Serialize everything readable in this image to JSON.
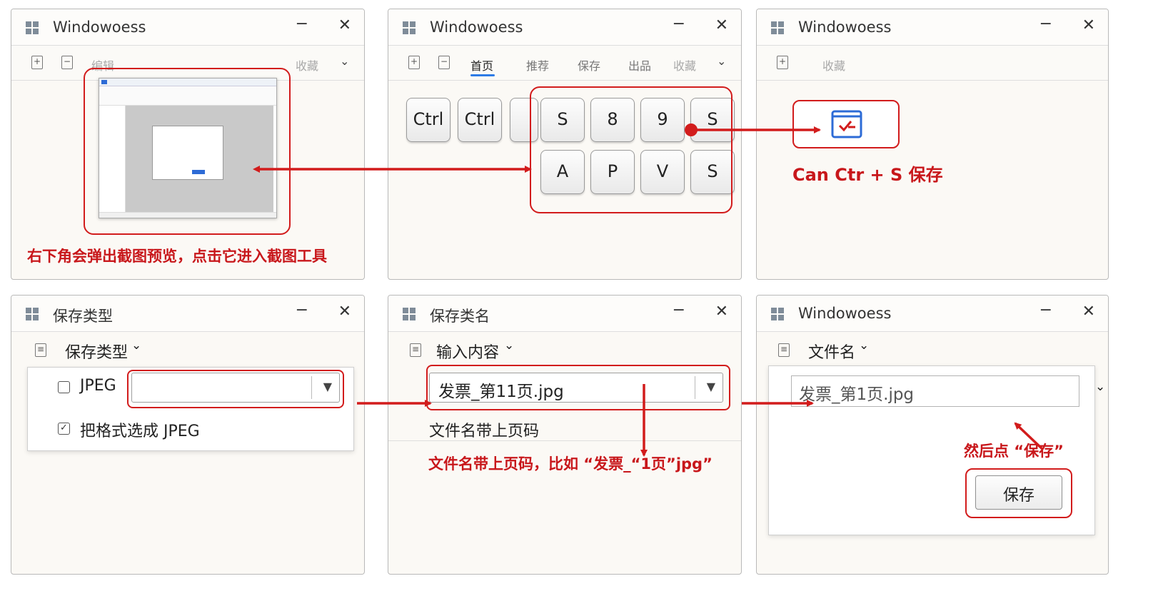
{
  "colors": {
    "accent_red": "#d21c1c",
    "tab_blue": "#2d7be6"
  },
  "icons": {
    "window": "windows-logo-icon",
    "add": "add-page-icon",
    "remove": "remove-page-icon",
    "doc": "document-icon",
    "save": "save-icon"
  },
  "p1": {
    "title": "Windowoess",
    "minimize": "−",
    "close": "✕",
    "toolbar_label": "编辑",
    "toolbar_right": "收藏",
    "chevron": "⌄",
    "caption": "右下角会弹出截图预览，点击它进入截图工具"
  },
  "p2": {
    "title": "Windowoess",
    "minimize": "−",
    "close": "✕",
    "tabs": [
      "首页",
      "推荐",
      "保存",
      "出品",
      "收藏"
    ],
    "chevron": "⌄",
    "left_keys": [
      "Ctrl",
      "Ctrl"
    ],
    "keys_row1": [
      "S",
      "8",
      "9",
      "S"
    ],
    "keys_row2": [
      "A",
      "P",
      "V",
      "S"
    ]
  },
  "p3": {
    "title": "Windowoess",
    "minimize": "−",
    "close": "✕",
    "toolbar_label": "收藏",
    "caption": "Can Ctr + S 保存"
  },
  "p4": {
    "title": "保存类型",
    "minimize": "−",
    "close": "✕",
    "menu": "保存类型",
    "chevron": "⌄",
    "option1": "JPEG",
    "option1_checked": false,
    "option2": "把格式选成 JPEG",
    "option2_checked": true,
    "combo_value": "",
    "combo_arrow": "▼"
  },
  "p5": {
    "title": "保存类名",
    "minimize": "−",
    "close": "✕",
    "menu": "输入内容",
    "chevron": "⌄",
    "combo_value": "发票_第11页.jpg",
    "combo_arrow": "▼",
    "hint": "文件名带上页码",
    "caption": "文件名带上页码，比如 “发票_“1页”jpg”"
  },
  "p6": {
    "title": "Windowoess",
    "minimize": "−",
    "close": "✕",
    "menu": "文件名",
    "chevron": "⌄",
    "filename_value": "发票_第1页.jpg",
    "side_chevron": "⌄",
    "caption": "然后点 “保存”",
    "save_button": "保存"
  }
}
